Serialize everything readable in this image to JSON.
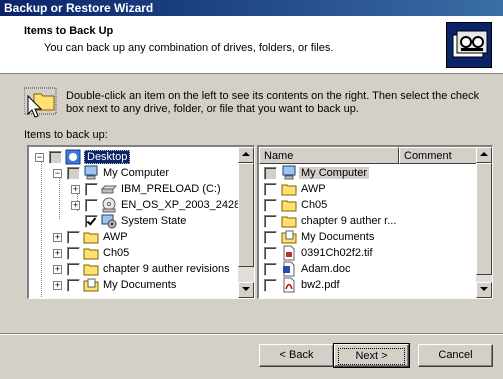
{
  "window": {
    "title": "Backup or Restore Wizard"
  },
  "header": {
    "title": "Items to Back Up",
    "subtitle": "You can back up any combination of drives, folders, or files.",
    "icon": "backup-wizard-icon"
  },
  "intro": {
    "text": "Double-click an item on the left to see its contents on the right. Then select the check box next to any drive, folder, or file that you want to back up.",
    "icon": "folder-cursor-icon"
  },
  "tree": {
    "label": "Items to back up:",
    "items": [
      {
        "label": "Desktop",
        "icon": "desktop-icon",
        "expander": "−",
        "checked": "grey",
        "selected": true
      },
      {
        "label": "My Computer",
        "icon": "computer-icon",
        "expander": "−",
        "checked": "grey"
      },
      {
        "label": "IBM_PRELOAD (C:)",
        "icon": "hard-drive-icon",
        "expander": "+",
        "checked": "off"
      },
      {
        "label": "EN_OS_XP_2003_2428",
        "icon": "cd-drive-icon",
        "expander": "+",
        "checked": "off"
      },
      {
        "label": "System State",
        "icon": "system-state-icon",
        "expander": "",
        "checked": "on"
      },
      {
        "label": "AWP",
        "icon": "folder-icon",
        "expander": "+",
        "checked": "off"
      },
      {
        "label": "Ch05",
        "icon": "folder-icon",
        "expander": "+",
        "checked": "off"
      },
      {
        "label": "chapter 9 auther revisions",
        "icon": "folder-icon",
        "expander": "+",
        "checked": "off"
      },
      {
        "label": "My Documents",
        "icon": "my-documents-icon",
        "expander": "+",
        "checked": "off"
      }
    ]
  },
  "list": {
    "columns": [
      "Name",
      "Comment"
    ],
    "items": [
      {
        "name": "My Computer",
        "icon": "computer-icon",
        "checked": "grey",
        "highlight": true
      },
      {
        "name": "AWP",
        "icon": "folder-icon",
        "checked": "off"
      },
      {
        "name": "Ch05",
        "icon": "folder-icon",
        "checked": "off"
      },
      {
        "name": "chapter 9 auther r...",
        "icon": "folder-icon",
        "checked": "off"
      },
      {
        "name": "My Documents",
        "icon": "my-documents-icon",
        "checked": "off"
      },
      {
        "name": "0391Ch02f2.tif",
        "icon": "image-file-icon",
        "checked": "off"
      },
      {
        "name": "Adam.doc",
        "icon": "word-doc-icon",
        "checked": "off"
      },
      {
        "name": "bw2.pdf",
        "icon": "pdf-file-icon",
        "checked": "off"
      }
    ]
  },
  "buttons": {
    "back": "< Back",
    "next": "Next >",
    "cancel": "Cancel"
  },
  "colors": {
    "titlebar": "#0a246a",
    "face": "#d4d0c8",
    "selection": "#0a246a"
  }
}
